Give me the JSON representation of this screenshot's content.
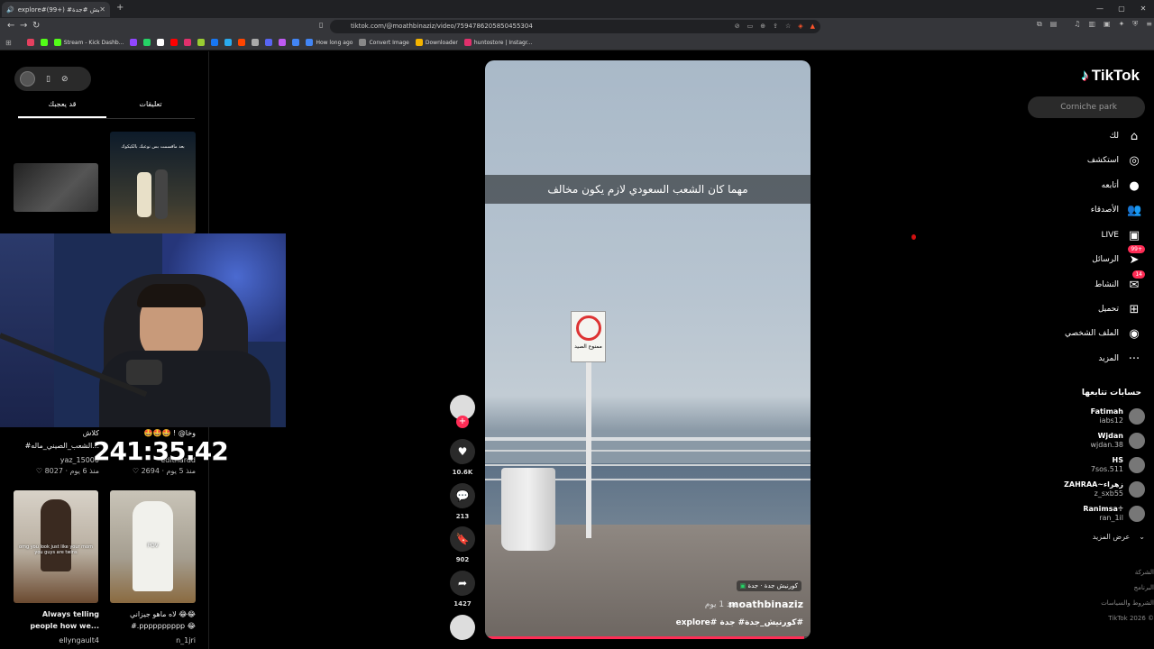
{
  "browser": {
    "tab_title": "explore#(99+) #كورنيش #جدة",
    "new_tab": "+",
    "url": "tiktok.com/@moathbinaziz/video/7594786205850455304",
    "window_controls": [
      "—",
      "▢",
      "✕"
    ]
  },
  "bookmarks": [
    {
      "label": "",
      "color": "#e4405f"
    },
    {
      "label": "",
      "color": "#53fc18"
    },
    {
      "label": "Stream - Kick Dashb...",
      "color": "#53fc18"
    },
    {
      "label": "",
      "color": "#9146ff"
    },
    {
      "label": "",
      "color": "#25d366"
    },
    {
      "label": "",
      "color": "#ffffff"
    },
    {
      "label": "",
      "color": "#ff0000"
    },
    {
      "label": "",
      "color": "#e1306c"
    },
    {
      "label": "",
      "color": "#9acd32"
    },
    {
      "label": "",
      "color": "#1877f2"
    },
    {
      "label": "",
      "color": "#2aabee"
    },
    {
      "label": "",
      "color": "#ff4500"
    },
    {
      "label": "",
      "color": "#aaaaaa"
    },
    {
      "label": "",
      "color": "#5865f2"
    },
    {
      "label": "",
      "color": "#bf5af2"
    },
    {
      "label": "",
      "color": "#4285f4"
    },
    {
      "label": "How long ago",
      "color": "#4285f4"
    },
    {
      "label": "Convert Image",
      "color": "#888888"
    },
    {
      "label": "Downloader",
      "color": "#f4b400"
    },
    {
      "label": "huntostore | Instagr...",
      "color": "#e1306c"
    }
  ],
  "left_panel": {
    "tabs": [
      "تعليقات",
      "قد يعجبك"
    ],
    "active_tab": "قد يعجبك",
    "timer": "241:35:42",
    "thumb_top_right_text": "بعد ماقسمت بس نوعبك بالكيكوك",
    "cards": [
      {
        "caption_1": "🤩🤩🤩 ! @وخا",
        "caption_2": "",
        "user": "edithardd",
        "age": "منذ 5 يوم",
        "likes": "2694"
      },
      {
        "caption_1": "كلاش",
        "caption_2": "#الشعب_الصيني_ماله...",
        "user": "yaz_15000",
        "age": "منذ 6 يوم",
        "likes": "8027"
      },
      {
        "caption_1": "لاه ماهو جيزاني 😂😂",
        "caption_2": "#.pppppppppp 😂",
        "user": "n_1jri",
        "age": "",
        "likes": ""
      },
      {
        "caption_1": "Always telling",
        "caption_2": "people how we...",
        "user": "ellyngault4",
        "age": "",
        "likes": ""
      }
    ],
    "tiktok_meme_text": "omg you look just like your mom you guys are twins",
    "pov_text": "POV"
  },
  "video": {
    "overlay_caption": "مهما كان الشعب السعودي لازم يكون مخالف",
    "sign_text": "ممنوع الصيد",
    "location": "كورنيش جدة · جدة",
    "username": "moathbinaziz",
    "posted": "منذ 1 يوم ·",
    "hashtags": "explore# كورنيش_جدة# جدة#",
    "progress": 0.98
  },
  "actions": {
    "likes": "10.6K",
    "comments": "213",
    "saves": "902",
    "shares": "1427",
    "follow_plus": "+"
  },
  "tiktok": {
    "logo": "TikTok",
    "search_placeholder": "Corniche park",
    "nav": [
      {
        "label": "لك",
        "icon": "⌂"
      },
      {
        "label": "استكشف",
        "icon": "◎"
      },
      {
        "label": "أتابعه",
        "icon": "●"
      },
      {
        "label": "الأصدقاء",
        "icon": "👥"
      },
      {
        "label": "LIVE",
        "icon": "▣"
      },
      {
        "label": "الرسائل",
        "icon": "➤",
        "badge": "99+"
      },
      {
        "label": "النشاط",
        "icon": "✉",
        "badge": "14"
      },
      {
        "label": "تحميل",
        "icon": "⊞"
      },
      {
        "label": "الملف الشخصي",
        "icon": "◉"
      },
      {
        "label": "المزيد",
        "icon": "···"
      }
    ],
    "following_heading": "حسابات تتابعها",
    "following": [
      {
        "name": "Fatimah",
        "handle": "iabs12"
      },
      {
        "name": "Wjdan",
        "handle": "wjdan.38"
      },
      {
        "name": "HS",
        "handle": "7sos.511"
      },
      {
        "name": "ZAHRAA~زهراء",
        "handle": "z_sxb55"
      },
      {
        "name": "Ranimsa♱",
        "handle": "ran_1il"
      }
    ],
    "see_more": "عرض المزيد",
    "footer": [
      "الشركة",
      "البرنامج",
      "الشروط والسياسات",
      "TikTok 2026 ©"
    ]
  }
}
